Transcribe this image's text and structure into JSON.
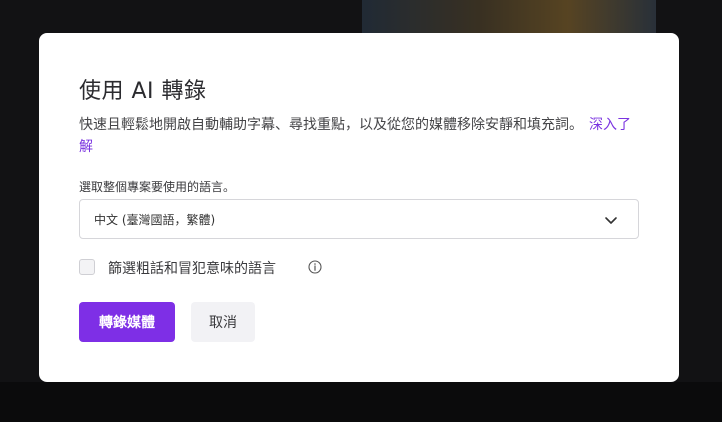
{
  "dialog": {
    "title": "使用 AI 轉錄",
    "description": "快速且輕鬆地開啟自動輔助字幕、尋找重點，以及從您的媒體移除安靜和填充詞。",
    "learn_more": "深入了解",
    "language_label": "選取整個專案要使用的語言。",
    "language_value": "中文 (臺灣國語，繁體)",
    "filter_checkbox_label": "篩選粗話和冒犯意味的語言",
    "filter_checked": false,
    "primary_button": "轉錄媒體",
    "secondary_button": "取消"
  },
  "colors": {
    "accent": "#7e2fe6",
    "link": "#7b34e0",
    "overlay": "#1c1c1f"
  },
  "icons": {
    "select_chevron": "chevron-down-icon",
    "info": "info-icon"
  }
}
